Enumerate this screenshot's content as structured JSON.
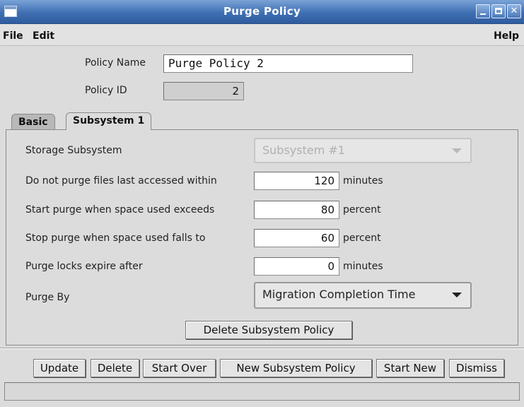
{
  "window": {
    "title": "Purge Policy"
  },
  "menu": {
    "file": "File",
    "edit": "Edit",
    "help": "Help"
  },
  "policy": {
    "name_label": "Policy Name",
    "name_value": "Purge Policy 2",
    "id_label": "Policy ID",
    "id_value": "2"
  },
  "tabs": [
    {
      "label": "Basic",
      "active": false
    },
    {
      "label": "Subsystem 1",
      "active": true
    }
  ],
  "subsystem": {
    "storage_label": "Storage Subsystem",
    "storage_value": "Subsystem #1",
    "rows": [
      {
        "label": "Do not purge files last accessed within",
        "value": "120",
        "unit": "minutes"
      },
      {
        "label": "Start purge when space used exceeds",
        "value": "80",
        "unit": "percent"
      },
      {
        "label": "Stop purge when space used falls to",
        "value": "60",
        "unit": "percent"
      },
      {
        "label": "Purge locks expire after",
        "value": "0",
        "unit": "minutes"
      }
    ],
    "purge_by_label": "Purge By",
    "purge_by_value": "Migration Completion Time",
    "delete_button": "Delete Subsystem Policy"
  },
  "buttons": {
    "update": "Update",
    "delete": "Delete",
    "start_over": "Start Over",
    "new_subsystem_policy": "New Subsystem Policy",
    "start_new": "Start New",
    "dismiss": "Dismiss"
  },
  "status": {
    "text": ""
  }
}
